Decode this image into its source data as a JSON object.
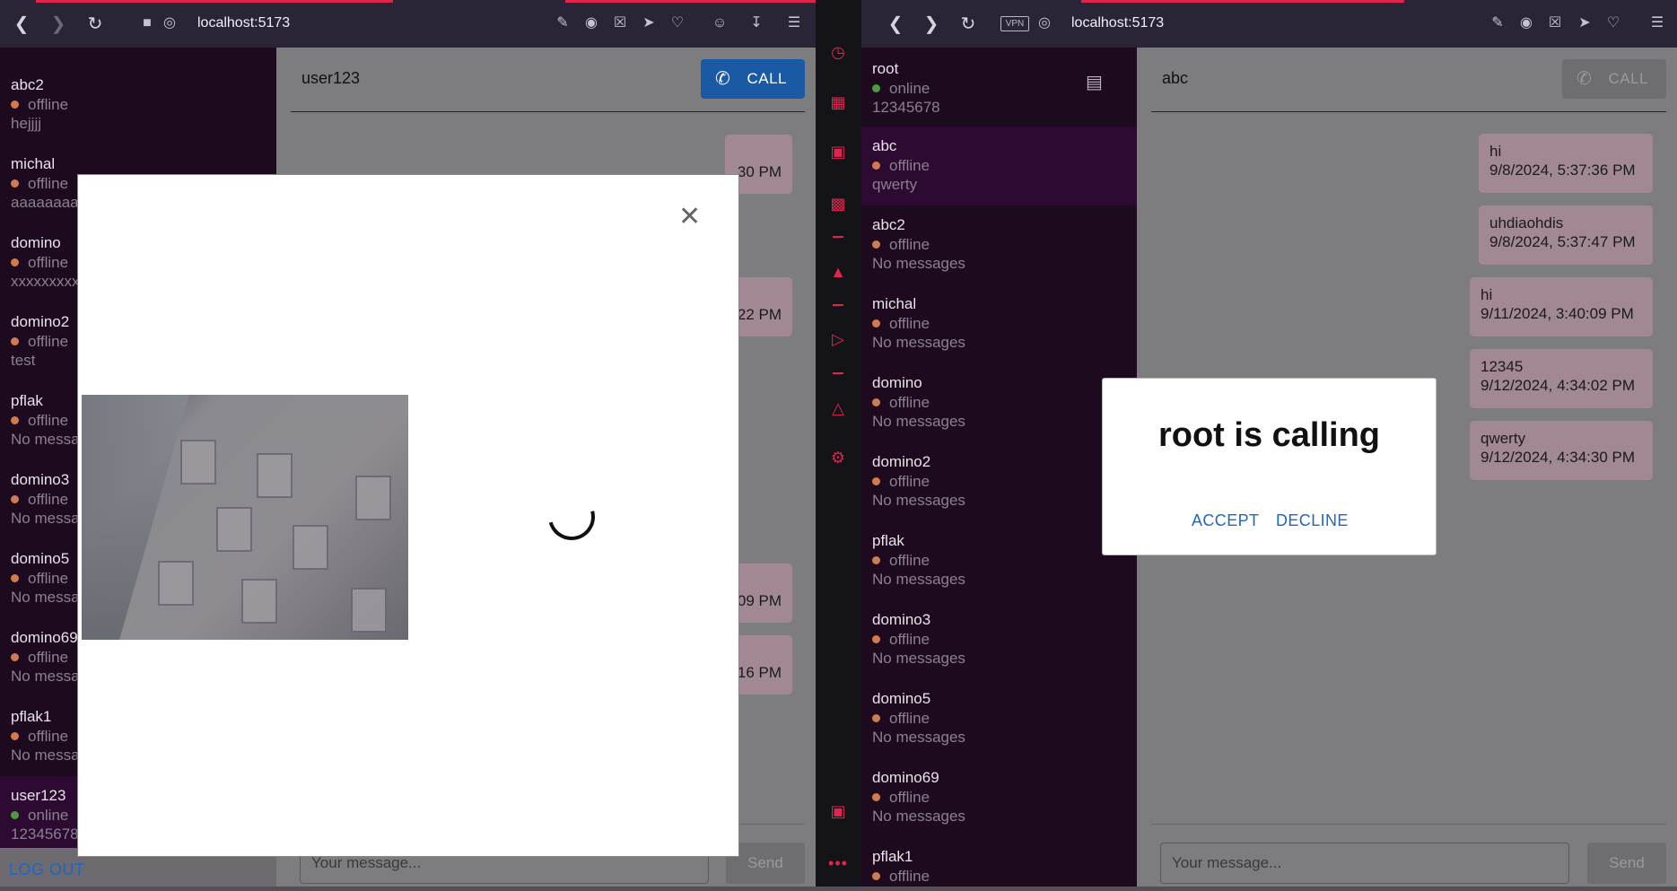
{
  "left_browser": {
    "url": "localhost:5173",
    "contacts": [
      {
        "name": "abc2",
        "status": "offline",
        "last": "hejjjj"
      },
      {
        "name": "michal",
        "status": "offline",
        "last": "aaaaaaaaa"
      },
      {
        "name": "domino",
        "status": "offline",
        "last": "xxxxxxxxx"
      },
      {
        "name": "domino2",
        "status": "offline",
        "last": "test"
      },
      {
        "name": "pflak",
        "status": "offline",
        "last": "No messa"
      },
      {
        "name": "domino3",
        "status": "offline",
        "last": "No messa"
      },
      {
        "name": "domino5",
        "status": "offline",
        "last": "No messa"
      },
      {
        "name": "domino69",
        "status": "offline",
        "last": "No messa"
      },
      {
        "name": "pflak1",
        "status": "offline",
        "last": "No messa"
      },
      {
        "name": "user123",
        "status": "online",
        "last": "12345678"
      }
    ],
    "logout_label": "LOG OUT",
    "chat_user": "user123",
    "call_label": "CALL",
    "bubble_times": [
      "30 PM",
      "22 PM",
      "09 PM",
      "16 PM"
    ],
    "message_placeholder": "Your message...",
    "send_label": "Send"
  },
  "right_browser": {
    "url": "localhost:5173",
    "vpn_label": "VPN",
    "contacts": [
      {
        "name": "root",
        "status": "online",
        "last": "12345678"
      },
      {
        "name": "abc",
        "status": "offline",
        "last": "qwerty"
      },
      {
        "name": "abc2",
        "status": "offline",
        "last": "No messages"
      },
      {
        "name": "michal",
        "status": "offline",
        "last": "No messages"
      },
      {
        "name": "domino",
        "status": "offline",
        "last": "No messages"
      },
      {
        "name": "domino2",
        "status": "offline",
        "last": "No messages"
      },
      {
        "name": "pflak",
        "status": "offline",
        "last": "No messages"
      },
      {
        "name": "domino3",
        "status": "offline",
        "last": "No messages"
      },
      {
        "name": "domino5",
        "status": "offline",
        "last": "No messages"
      },
      {
        "name": "domino69",
        "status": "offline",
        "last": "No messages"
      },
      {
        "name": "pflak1",
        "status": "offline",
        "last": ""
      }
    ],
    "chat_user": "abc",
    "call_label": "CALL",
    "messages": [
      {
        "text": "hi",
        "time": "9/8/2024, 5:37:36 PM"
      },
      {
        "text": "uhdiaohdis",
        "time": "9/8/2024, 5:37:47 PM"
      },
      {
        "text": "hi",
        "time": "9/11/2024, 3:40:09 PM"
      },
      {
        "text": "12345",
        "time": "9/12/2024, 4:34:02 PM"
      },
      {
        "text": "qwerty",
        "time": "9/12/2024, 4:34:30 PM"
      }
    ],
    "incoming_call": {
      "title": "root is calling",
      "accept": "ACCEPT",
      "decline": "DECLINE"
    },
    "message_placeholder": "Your message...",
    "send_label": "Send"
  },
  "colors": {
    "accent": "#e0244c",
    "sidebar": "#1e0a1f",
    "selected": "#2d0a31",
    "link": "#1f67c0",
    "bubble": "#a28894"
  }
}
